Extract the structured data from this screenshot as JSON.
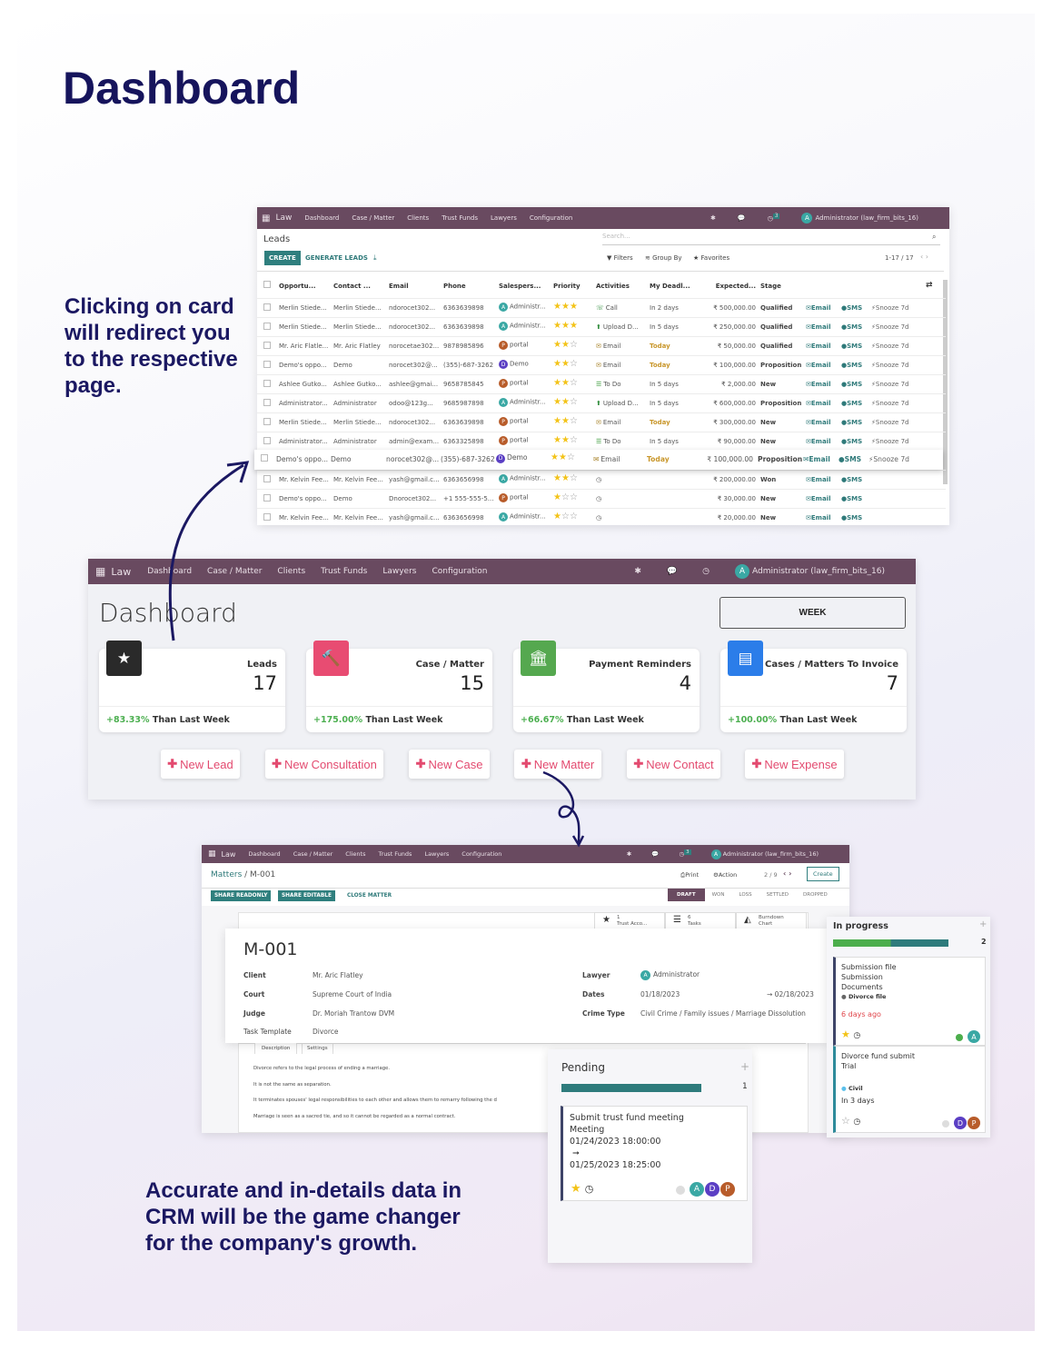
{
  "headline": "Dashboard",
  "blurb_top": "Clicking on card will redirect you to the respective page.",
  "blurb_bottom": "Accurate and in-details data in CRM will be the game changer for the company's growth.",
  "colors": {
    "nav": "#694a60",
    "teal": "#2f7f7e",
    "accent_red": "#e34a6f",
    "positive": "#4caf50",
    "heading": "#16145c"
  },
  "nav": {
    "app": "Law",
    "items": [
      "Dashboard",
      "Case / Matter",
      "Clients",
      "Trust Funds",
      "Lawyers",
      "Configuration"
    ],
    "user": "Administrator (law_firm_bits_16)",
    "user_initial": "A",
    "activity_count": "3"
  },
  "leads": {
    "title": "Leads",
    "search_placeholder": "Search...",
    "create": "CREATE",
    "generate": "GENERATE LEADS",
    "filters": "Filters",
    "group_by": "Group By",
    "favorites": "Favorites",
    "pager": "1-17 / 17",
    "columns": [
      "Opportu...",
      "Contact ...",
      "Email",
      "Phone",
      "Salespers...",
      "Priority",
      "Activities",
      "My Deadl...",
      "Expected...",
      "Stage"
    ],
    "action_labels": {
      "email": "Email",
      "sms": "SMS",
      "snooze": "Snooze 7d"
    },
    "rows": [
      {
        "opp": "Merlin Stiede...",
        "contact": "Merlin Stiede...",
        "email": "ndorocet302...",
        "phone": "6363639898",
        "sp": "Administr...",
        "spi": "A",
        "stars": 3,
        "act": "Call",
        "acticon": "phone",
        "deadline": "In 2 days",
        "exp": "₹ 500,000.00",
        "stage": "Qualified",
        "snooze": true
      },
      {
        "opp": "Merlin Stiede...",
        "contact": "Merlin Stiede...",
        "email": "ndorocet302...",
        "phone": "6363639898",
        "sp": "Administr...",
        "spi": "A",
        "stars": 3,
        "act": "Upload D...",
        "acticon": "upload",
        "deadline": "In 5 days",
        "exp": "₹ 250,000.00",
        "stage": "Qualified",
        "snooze": true
      },
      {
        "opp": "Mr. Aric Flatle...",
        "contact": "Mr. Aric Flatley",
        "email": "norocetae302...",
        "phone": "9878985896",
        "sp": "portal",
        "spi": "P",
        "stars": 2,
        "act": "Email",
        "acticon": "envelope",
        "deadline": "Today",
        "exp": "₹ 50,000.00",
        "stage": "Qualified",
        "snooze": true
      },
      {
        "opp": "Demo's oppo...",
        "contact": "Demo",
        "email": "norocet302@...",
        "phone": "(355)-687-3262",
        "sp": "Demo",
        "spi": "D",
        "stars": 2,
        "act": "Email",
        "acticon": "envelope",
        "deadline": "Today",
        "exp": "₹ 100,000.00",
        "stage": "Proposition",
        "snooze": true
      },
      {
        "opp": "Ashlee Gutko...",
        "contact": "Ashlee Gutko...",
        "email": "ashlee@gmai...",
        "phone": "9658785845",
        "sp": "portal",
        "spi": "P",
        "stars": 2,
        "act": "To Do",
        "acticon": "todo",
        "deadline": "In 5 days",
        "exp": "₹ 2,000.00",
        "stage": "New",
        "snooze": true
      },
      {
        "opp": "Administrator...",
        "contact": "Administrator",
        "email": "odoo@123g...",
        "phone": "9685987898",
        "sp": "Administr...",
        "spi": "A",
        "stars": 2,
        "act": "Upload D...",
        "acticon": "upload",
        "deadline": "In 5 days",
        "exp": "₹ 600,000.00",
        "stage": "Proposition",
        "snooze": true
      },
      {
        "opp": "Merlin Stiede...",
        "contact": "Merlin Stiede...",
        "email": "ndorocet302...",
        "phone": "6363639898",
        "sp": "portal",
        "spi": "P",
        "stars": 2,
        "act": "Email",
        "acticon": "envelope",
        "deadline": "Today",
        "exp": "₹ 300,000.00",
        "stage": "New",
        "snooze": true
      },
      {
        "opp": "Administrator...",
        "contact": "Administrator",
        "email": "admin@exam...",
        "phone": "6363325898",
        "sp": "portal",
        "spi": "P",
        "stars": 2,
        "act": "To Do",
        "acticon": "todo",
        "deadline": "In 5 days",
        "exp": "₹ 90,000.00",
        "stage": "New",
        "snooze": true
      },
      {
        "opp": "Demo's oppo...",
        "contact": "Demo",
        "email": "norocet302@...",
        "phone": "(355)-687-3262",
        "sp": "Demo",
        "spi": "D",
        "stars": 2,
        "act": "Email",
        "acticon": "envelope",
        "deadline": "Today",
        "exp": "₹ 100,000.00",
        "stage": "Proposition",
        "snooze": true,
        "highlighted": true
      },
      {
        "opp": "Mr. Kelvin Fee...",
        "contact": "Mr. Kelvin Fee...",
        "email": "yash@gmail.c...",
        "phone": "6363656998",
        "sp": "Administr...",
        "spi": "A",
        "stars": 2,
        "act": "",
        "acticon": "clock",
        "deadline": "",
        "exp": "₹ 200,000.00",
        "stage": "Won",
        "snooze": false
      },
      {
        "opp": "Demo's oppo...",
        "contact": "Demo",
        "email": "Dnorocet302...",
        "phone": "+1 555-555-5...",
        "sp": "portal",
        "spi": "P",
        "stars": 1,
        "act": "",
        "acticon": "clock",
        "deadline": "",
        "exp": "₹ 30,000.00",
        "stage": "New",
        "snooze": false
      },
      {
        "opp": "Mr. Kelvin Fee...",
        "contact": "Mr. Kelvin Fee...",
        "email": "yash@gmail.c...",
        "phone": "6363656998",
        "sp": "Administr...",
        "spi": "A",
        "stars": 1,
        "act": "",
        "acticon": "clock",
        "deadline": "",
        "exp": "₹ 20,000.00",
        "stage": "New",
        "snooze": false
      }
    ],
    "avatar_colors": {
      "A": "#3aa8a4",
      "P": "#b85c2a",
      "D": "#5b3fc4"
    }
  },
  "dashboard": {
    "title": "Dashboard",
    "period": "WEEK",
    "cards": [
      {
        "label": "Leads",
        "value": "17",
        "change": "+83.33%",
        "suffix": "Than Last Week",
        "icon": "star-icon",
        "color": "#2a2a2a"
      },
      {
        "label": "Case / Matter",
        "value": "15",
        "change": "+175.00%",
        "suffix": "Than Last Week",
        "icon": "gavel-icon",
        "color": "#e84c72"
      },
      {
        "label": "Payment Reminders",
        "value": "4",
        "change": "+66.67%",
        "suffix": "Than Last Week",
        "icon": "bank-icon",
        "color": "#55a84f"
      },
      {
        "label": "Cases / Matters To Invoice",
        "value": "7",
        "change": "+100.00%",
        "suffix": "Than Last Week",
        "icon": "document-icon",
        "color": "#2b7de9"
      }
    ],
    "quick_actions": [
      "New Lead",
      "New Consultation",
      "New Case",
      "New Matter",
      "New Contact",
      "New Expense"
    ]
  },
  "matter": {
    "breadcrumb_parent": "Matters",
    "breadcrumb_current": "M-001",
    "print": "Print",
    "action": "Action",
    "pager": "2 / 9",
    "create": "Create",
    "share_readonly": "SHARE READONLY",
    "share_editable": "SHARE EDITABLE",
    "close_matter": "CLOSE MATTER",
    "stages": [
      "DRAFT",
      "WON",
      "LOSS",
      "SETTLED",
      "DROPPED"
    ],
    "active_stage": "DRAFT",
    "smart_buttons": [
      {
        "count": "1",
        "label": "Trust Acco..."
      },
      {
        "count": "6",
        "label": "Tasks"
      },
      {
        "count": "Burndown",
        "label": "Chart"
      }
    ],
    "name": "M-001",
    "fields_left": [
      {
        "label": "Client",
        "value": "Mr. Aric Flatley"
      },
      {
        "label": "Court",
        "value": "Supreme Court of India"
      },
      {
        "label": "Judge",
        "value": "Dr. Moriah Trantow DVM"
      },
      {
        "label": "Task Template",
        "value": "Divorce"
      }
    ],
    "lawyer_label": "Lawyer",
    "lawyer": "Administrator",
    "dates_label": "Dates",
    "date_start": "01/18/2023",
    "date_end": "02/18/2023",
    "crime_label": "Crime Type",
    "crime": "Civil Crime / Family issues / Marriage Dissolution",
    "tabs": [
      "Description",
      "Settings"
    ],
    "description": [
      "Divorce refers to the legal process of ending a marriage.",
      "It is not the same as separation.",
      "It terminates spouses' legal responsibilities to each other and allows them to remarry following the d",
      "Marriage is seen as a sacred tie, and so it cannot be regarded as a normal contract."
    ]
  },
  "pending": {
    "title": "Pending",
    "count": "1",
    "card": {
      "title": "Submit trust fund meeting",
      "type": "Meeting",
      "start": "01/24/2023 18:00:00",
      "end": "01/25/2023 18:25:00",
      "avatars": [
        "A",
        "D",
        "P"
      ]
    }
  },
  "in_progress": {
    "title": "In progress",
    "count": "2",
    "cards": [
      {
        "lines": [
          "Submission file",
          "Submission",
          "Documents"
        ],
        "tag": "Divorce file",
        "due": "6 days ago",
        "avatars": [
          "A"
        ],
        "starred": true
      },
      {
        "lines": [
          "Divorce fund submit",
          "Trial"
        ],
        "tag": "Civil",
        "due": "In 3 days",
        "avatars": [
          "D",
          "P"
        ],
        "starred": false
      }
    ]
  }
}
